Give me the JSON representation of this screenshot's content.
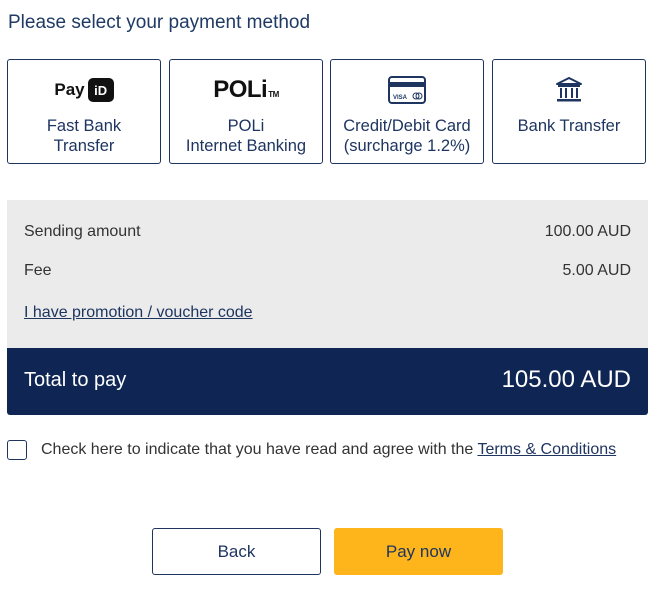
{
  "header": {
    "title": "Please select your payment method"
  },
  "methods": [
    {
      "icon": "payid-logo",
      "logo_text": "Pay",
      "logo_box": "iD",
      "line1": "Fast Bank",
      "line2": "Transfer"
    },
    {
      "icon": "poli-logo",
      "logo_text": "POLi",
      "logo_tm": "TM",
      "line1": "POLi",
      "line2": "Internet Banking"
    },
    {
      "icon": "credit-card-icon",
      "card_text": "VISA",
      "line1": "Credit/Debit Card",
      "line2": "(surcharge 1.2%)"
    },
    {
      "icon": "bank-icon",
      "line1": "Bank Transfer"
    }
  ],
  "summary": {
    "sending_label": "Sending amount",
    "sending_value": "100.00 AUD",
    "fee_label": "Fee",
    "fee_value": "5.00 AUD",
    "voucher_link": "I have promotion / voucher code"
  },
  "total": {
    "label": "Total to pay",
    "value": "105.00 AUD"
  },
  "terms": {
    "text": "Check here to indicate that you have read and agree with the ",
    "link": "Terms & Conditions"
  },
  "buttons": {
    "back": "Back",
    "pay": "Pay now"
  },
  "colors": {
    "navy": "#0f2654",
    "accent": "#fdb51b",
    "summary_bg": "#ebebeb"
  }
}
